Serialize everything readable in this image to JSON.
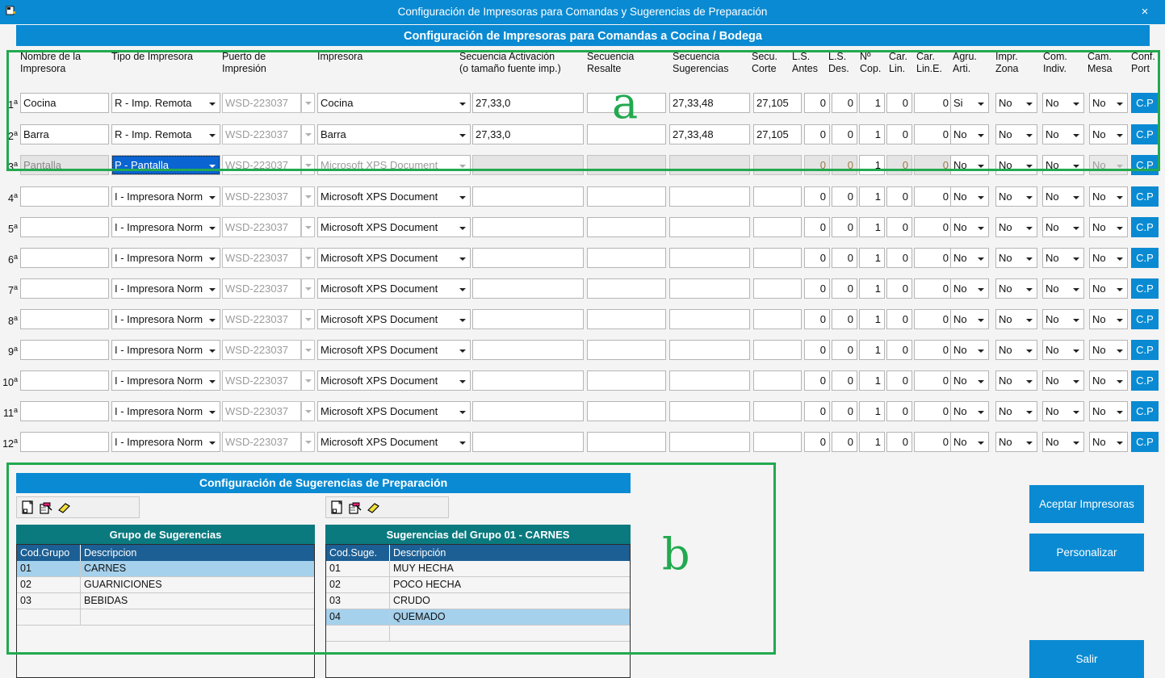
{
  "window": {
    "title": "Configuración de Impresoras para Comandas y Sugerencias de Preparación",
    "close_label": "×",
    "icon": "printer-icon"
  },
  "banner": {
    "text": "Configuración de Impresoras para Comandas a Cocina / Bodega"
  },
  "grid": {
    "headers": [
      "Nombre de la\nImpresora",
      "Tipo de Impresora",
      "Puerto de\nImpresión",
      "Impresora",
      "Secuencia Activación\n(o tamaño fuente imp.)",
      "Secuencia\nResalte",
      "Secuencia\nSugerencias",
      "Secu.\nCorte",
      "L.S.\nAntes",
      "L.S.\nDes.",
      "Nº\nCop.",
      "Car.\nLin.",
      "Car.\nLin.E.",
      "Agru.\nArti.",
      "Impr.\nZona",
      "Com.\nIndiv.",
      "Cam.\nMesa",
      "Conf.\nPort"
    ],
    "cp_label": "C.P",
    "rows": [
      {
        "label": "1",
        "sup": "a",
        "disabled": false,
        "type_highlight": false,
        "nombre": "Cocina",
        "tipo": "R - Imp. Remota",
        "puerto": "WSD-223037",
        "impresora": "Cocina",
        "secuencia_activacion": "27,33,0",
        "secuencia_resalte": "",
        "secuencia_sugerencias": "27,33,48",
        "secu_corte": "27,105",
        "ls_antes": "0",
        "ls_des": "0",
        "n_cop": "1",
        "car_lin": "0",
        "car_lin_e": "0",
        "agru_arti": "Si",
        "impr_zona": "No",
        "com_indiv": "No",
        "cam_mesa": "No"
      },
      {
        "label": "2",
        "sup": "a",
        "disabled": false,
        "type_highlight": false,
        "nombre": "Barra",
        "tipo": "R - Imp. Remota",
        "puerto": "WSD-223037",
        "impresora": "Barra",
        "secuencia_activacion": "27,33,0",
        "secuencia_resalte": "",
        "secuencia_sugerencias": "27,33,48",
        "secu_corte": "27,105",
        "ls_antes": "0",
        "ls_des": "0",
        "n_cop": "1",
        "car_lin": "0",
        "car_lin_e": "0",
        "agru_arti": "No",
        "impr_zona": "No",
        "com_indiv": "No",
        "cam_mesa": "No"
      },
      {
        "label": "3",
        "sup": "a",
        "disabled": true,
        "type_highlight": true,
        "nombre": "Pantalla",
        "tipo": "P - Pantalla",
        "puerto": "WSD-223037",
        "impresora": "Microsoft XPS Document",
        "secuencia_activacion": "",
        "secuencia_resalte": "",
        "secuencia_sugerencias": "",
        "secu_corte": "",
        "ls_antes": "0",
        "ls_des": "0",
        "n_cop": "1",
        "car_lin": "0",
        "car_lin_e": "0",
        "agru_arti": "No",
        "impr_zona": "No",
        "com_indiv": "No",
        "cam_mesa": "No"
      },
      {
        "label": "4",
        "sup": "a",
        "disabled": false,
        "type_highlight": false,
        "nombre": "",
        "tipo": "I - Impresora Norm",
        "puerto": "WSD-223037",
        "impresora": "Microsoft XPS Document",
        "secuencia_activacion": "",
        "secuencia_resalte": "",
        "secuencia_sugerencias": "",
        "secu_corte": "",
        "ls_antes": "0",
        "ls_des": "0",
        "n_cop": "1",
        "car_lin": "0",
        "car_lin_e": "0",
        "agru_arti": "No",
        "impr_zona": "No",
        "com_indiv": "No",
        "cam_mesa": "No"
      },
      {
        "label": "5",
        "sup": "a",
        "disabled": false,
        "type_highlight": false,
        "nombre": "",
        "tipo": "I - Impresora Norm",
        "puerto": "WSD-223037",
        "impresora": "Microsoft XPS Document",
        "secuencia_activacion": "",
        "secuencia_resalte": "",
        "secuencia_sugerencias": "",
        "secu_corte": "",
        "ls_antes": "0",
        "ls_des": "0",
        "n_cop": "1",
        "car_lin": "0",
        "car_lin_e": "0",
        "agru_arti": "No",
        "impr_zona": "No",
        "com_indiv": "No",
        "cam_mesa": "No"
      },
      {
        "label": "6",
        "sup": "a",
        "disabled": false,
        "type_highlight": false,
        "nombre": "",
        "tipo": "I - Impresora Norm",
        "puerto": "WSD-223037",
        "impresora": "Microsoft XPS Document",
        "secuencia_activacion": "",
        "secuencia_resalte": "",
        "secuencia_sugerencias": "",
        "secu_corte": "",
        "ls_antes": "0",
        "ls_des": "0",
        "n_cop": "1",
        "car_lin": "0",
        "car_lin_e": "0",
        "agru_arti": "No",
        "impr_zona": "No",
        "com_indiv": "No",
        "cam_mesa": "No"
      },
      {
        "label": "7",
        "sup": "a",
        "disabled": false,
        "type_highlight": false,
        "nombre": "",
        "tipo": "I - Impresora Norm",
        "puerto": "WSD-223037",
        "impresora": "Microsoft XPS Document",
        "secuencia_activacion": "",
        "secuencia_resalte": "",
        "secuencia_sugerencias": "",
        "secu_corte": "",
        "ls_antes": "0",
        "ls_des": "0",
        "n_cop": "1",
        "car_lin": "0",
        "car_lin_e": "0",
        "agru_arti": "No",
        "impr_zona": "No",
        "com_indiv": "No",
        "cam_mesa": "No"
      },
      {
        "label": "8",
        "sup": "a",
        "disabled": false,
        "type_highlight": false,
        "nombre": "",
        "tipo": "I - Impresora Norm",
        "puerto": "WSD-223037",
        "impresora": "Microsoft XPS Document",
        "secuencia_activacion": "",
        "secuencia_resalte": "",
        "secuencia_sugerencias": "",
        "secu_corte": "",
        "ls_antes": "0",
        "ls_des": "0",
        "n_cop": "1",
        "car_lin": "0",
        "car_lin_e": "0",
        "agru_arti": "No",
        "impr_zona": "No",
        "com_indiv": "No",
        "cam_mesa": "No"
      },
      {
        "label": "9",
        "sup": "a",
        "disabled": false,
        "type_highlight": false,
        "nombre": "",
        "tipo": "I - Impresora Norm",
        "puerto": "WSD-223037",
        "impresora": "Microsoft XPS Document",
        "secuencia_activacion": "",
        "secuencia_resalte": "",
        "secuencia_sugerencias": "",
        "secu_corte": "",
        "ls_antes": "0",
        "ls_des": "0",
        "n_cop": "1",
        "car_lin": "0",
        "car_lin_e": "0",
        "agru_arti": "No",
        "impr_zona": "No",
        "com_indiv": "No",
        "cam_mesa": "No"
      },
      {
        "label": "10",
        "sup": "a",
        "disabled": false,
        "type_highlight": false,
        "nombre": "",
        "tipo": "I - Impresora Norm",
        "puerto": "WSD-223037",
        "impresora": "Microsoft XPS Document",
        "secuencia_activacion": "",
        "secuencia_resalte": "",
        "secuencia_sugerencias": "",
        "secu_corte": "",
        "ls_antes": "0",
        "ls_des": "0",
        "n_cop": "1",
        "car_lin": "0",
        "car_lin_e": "0",
        "agru_arti": "No",
        "impr_zona": "No",
        "com_indiv": "No",
        "cam_mesa": "No"
      },
      {
        "label": "11",
        "sup": "a",
        "disabled": false,
        "type_highlight": false,
        "nombre": "",
        "tipo": "I - Impresora Norm",
        "puerto": "WSD-223037",
        "impresora": "Microsoft XPS Document",
        "secuencia_activacion": "",
        "secuencia_resalte": "",
        "secuencia_sugerencias": "",
        "secu_corte": "",
        "ls_antes": "0",
        "ls_des": "0",
        "n_cop": "1",
        "car_lin": "0",
        "car_lin_e": "0",
        "agru_arti": "No",
        "impr_zona": "No",
        "com_indiv": "No",
        "cam_mesa": "No"
      },
      {
        "label": "12",
        "sup": "a",
        "disabled": false,
        "type_highlight": false,
        "nombre": "",
        "tipo": "I - Impresora Norm",
        "puerto": "WSD-223037",
        "impresora": "Microsoft XPS Document",
        "secuencia_activacion": "",
        "secuencia_resalte": "",
        "secuencia_sugerencias": "",
        "secu_corte": "",
        "ls_antes": "0",
        "ls_des": "0",
        "n_cop": "1",
        "car_lin": "0",
        "car_lin_e": "0",
        "agru_arti": "No",
        "impr_zona": "No",
        "com_indiv": "No",
        "cam_mesa": "No"
      }
    ]
  },
  "suggestions": {
    "title": "Configuración de Sugerencias de Preparación",
    "toolbar_icons": [
      "new-document-icon",
      "edit-pencil-icon",
      "eraser-icon"
    ],
    "groups_panel": {
      "title": "Grupo de Sugerencias",
      "columns": [
        "Cod.Grupo",
        "Descripcion"
      ],
      "rows": [
        {
          "cod": "01",
          "desc": "CARNES",
          "selected": true
        },
        {
          "cod": "02",
          "desc": "GUARNICIONES",
          "selected": false
        },
        {
          "cod": "03",
          "desc": "BEBIDAS",
          "selected": false
        },
        {
          "cod": "",
          "desc": "",
          "selected": false
        }
      ]
    },
    "items_panel": {
      "title": "Sugerencias del Grupo 01 - CARNES",
      "columns": [
        "Cod.Suge.",
        "Descripción"
      ],
      "rows": [
        {
          "cod": "01",
          "desc": "MUY HECHA",
          "selected": false
        },
        {
          "cod": "02",
          "desc": "POCO HECHA",
          "selected": false
        },
        {
          "cod": "03",
          "desc": "CRUDO",
          "selected": false
        },
        {
          "cod": "04",
          "desc": "QUEMADO",
          "selected": true
        },
        {
          "cod": "",
          "desc": "",
          "selected": false
        }
      ]
    }
  },
  "actions": {
    "accept": "Aceptar Impresoras",
    "customize": "Personalizar",
    "exit": "Salir"
  },
  "annotations": [
    {
      "letter": "a"
    },
    {
      "letter": "b"
    }
  ],
  "colors": {
    "accent": "#0a8ad2",
    "teal": "#0a7a7f",
    "header_blue": "#1c5f94",
    "selection": "#a6d1ec",
    "annotation_green": "#22a94f"
  }
}
